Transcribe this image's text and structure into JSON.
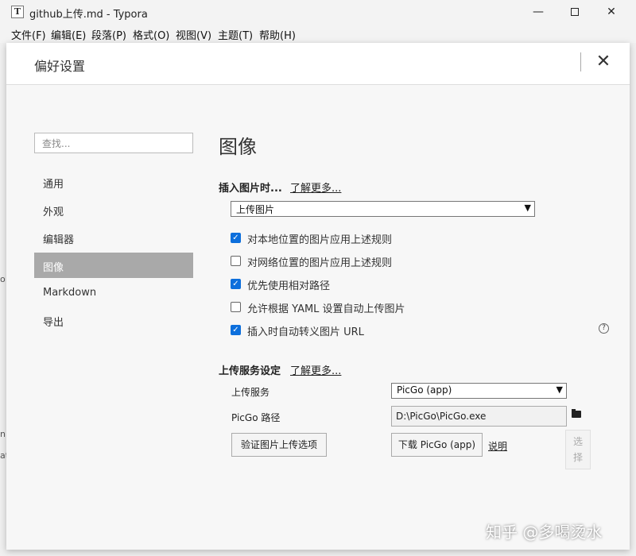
{
  "window": {
    "title": "github上传.md - Typora",
    "app_icon": "T",
    "controls": {
      "minimize": "—",
      "maximize": "",
      "close": "✕"
    }
  },
  "menu": [
    "文件(F)",
    "编辑(E)",
    "段落(P)",
    "格式(O)",
    "视图(V)",
    "主题(T)",
    "帮助(H)"
  ],
  "background_fragments": [
    "o",
    "n",
    "at"
  ],
  "preferences": {
    "title": "偏好设置",
    "close": "✕",
    "search_placeholder": "查找...",
    "nav": [
      "通用",
      "外观",
      "编辑器",
      "图像",
      "Markdown",
      "导出"
    ],
    "active_nav": "图像",
    "section_title": "图像",
    "insert_label": "插入图片时...",
    "learn_more": "了解更多...",
    "insert_select": "上传图片",
    "checks": [
      {
        "label": "对本地位置的图片应用上述规则",
        "checked": true
      },
      {
        "label": "对网络位置的图片应用上述规则",
        "checked": false
      },
      {
        "label": "优先使用相对路径",
        "checked": true
      },
      {
        "label": "允许根据 YAML 设置自动上传图片",
        "checked": false
      },
      {
        "label": "插入时自动转义图片 URL",
        "checked": true
      }
    ],
    "help": "?",
    "upload_heading": "上传服务设定",
    "upload_service_label": "上传服务",
    "upload_service_value": "PicGo (app)",
    "picgo_path_label": "PicGo 路径",
    "picgo_path_value": "D:\\PicGo\\PicGo.exe",
    "verify_button": "验证图片上传选项",
    "download_button": "下载 PicGo (app)",
    "explain_link": "说明",
    "tooltip_text": "选择",
    "tooltip_line1": "选",
    "tooltip_line2": "择"
  },
  "watermark": "知乎 @多喝烫水"
}
